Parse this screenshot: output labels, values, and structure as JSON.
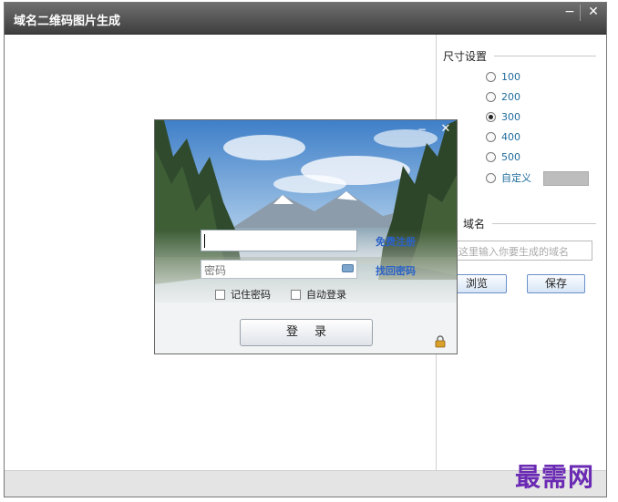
{
  "window": {
    "title": "域名二维码图片生成",
    "min_glyph": "−",
    "close_glyph": "✕"
  },
  "size_settings": {
    "heading": "尺寸设置",
    "options": [
      "100",
      "200",
      "300",
      "400",
      "500",
      "自定义"
    ],
    "selected": "300"
  },
  "domain": {
    "heading": "域名",
    "placeholder": "在这里输入你要生成的域名",
    "browse_label": "浏览",
    "save_label": "保存"
  },
  "login": {
    "password_placeholder": "密码",
    "register_link": "免费注册",
    "recover_link": "找回密码",
    "remember_label": "记住密码",
    "autologin_label": "自动登录",
    "login_button": "登录",
    "close_glyph": "✕",
    "min_glyph": "−"
  },
  "watermark": "最需网",
  "colors": {
    "link": "#2a62c8",
    "radio_label": "#1e6b9c",
    "watermark": "#6a2ab3"
  }
}
